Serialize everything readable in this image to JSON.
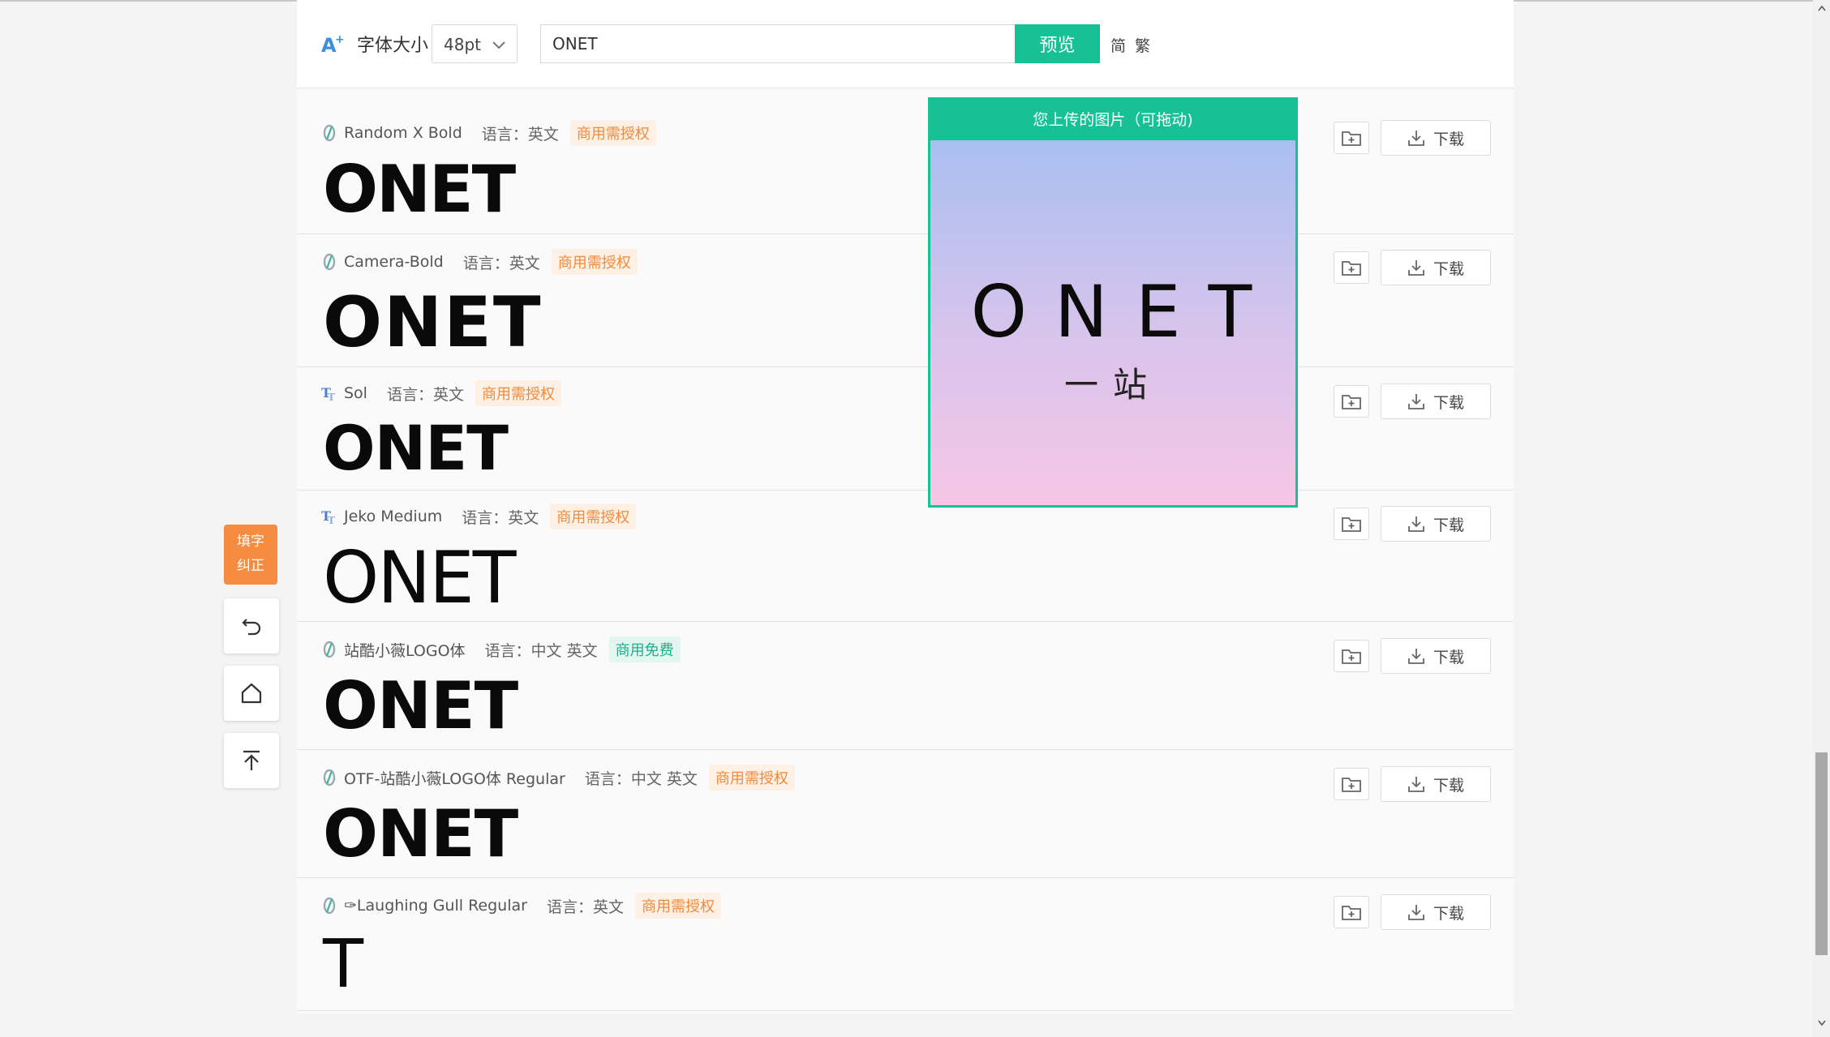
{
  "toolbar": {
    "font_size_label": "字体大小",
    "font_size_value": "48pt",
    "text_value": "ONET",
    "preview_label": "预览",
    "simplified_label": "简",
    "traditional_label": "繁"
  },
  "upload_panel": {
    "title": "您上传的图片（可拖动)",
    "image_text_big": "ONET",
    "image_text_small": "一站"
  },
  "side_tools": {
    "fix_line1": "填字",
    "fix_line2": "纠正"
  },
  "fonts": [
    {
      "name": "Random X Bold",
      "lang": "语言：英文",
      "license": "商用需授权",
      "license_type": "paid",
      "sample": "ONET",
      "icon": "otf-font-icon"
    },
    {
      "name": "Camera-Bold",
      "lang": "语言：英文",
      "license": "商用需授权",
      "license_type": "paid",
      "sample": "ONET",
      "icon": "otf-font-icon"
    },
    {
      "name": "Sol",
      "lang": "语言：英文",
      "license": "商用需授权",
      "license_type": "paid",
      "sample": "ONET",
      "icon": "ttf-font-icon"
    },
    {
      "name": "Jeko Medium",
      "lang": "语言：英文",
      "license": "商用需授权",
      "license_type": "paid",
      "sample": "ONET",
      "icon": "ttf-font-icon"
    },
    {
      "name": "站酷小薇LOGO体",
      "lang": "语言：中文 英文",
      "license": "商用免费",
      "license_type": "free",
      "sample": "ONET",
      "icon": "otf-font-icon"
    },
    {
      "name": "OTF-站酷小薇LOGO体 Regular",
      "lang": "语言：中文 英文",
      "license": "商用需授权",
      "license_type": "paid",
      "sample": "ONET",
      "icon": "otf-font-icon"
    },
    {
      "name": "✑Laughing Gull Regular",
      "lang": "语言：英文",
      "license": "商用需授权",
      "license_type": "paid",
      "sample": "T",
      "icon": "otf-font-icon"
    }
  ],
  "download_label": "下载",
  "colors": {
    "accent": "#17c195",
    "orange": "#f68c3f",
    "paid_tag_bg": "#fdf0e4",
    "paid_tag_text": "#f28a3b",
    "free_tag_bg": "#e3f6ef",
    "free_tag_text": "#17b38b"
  }
}
